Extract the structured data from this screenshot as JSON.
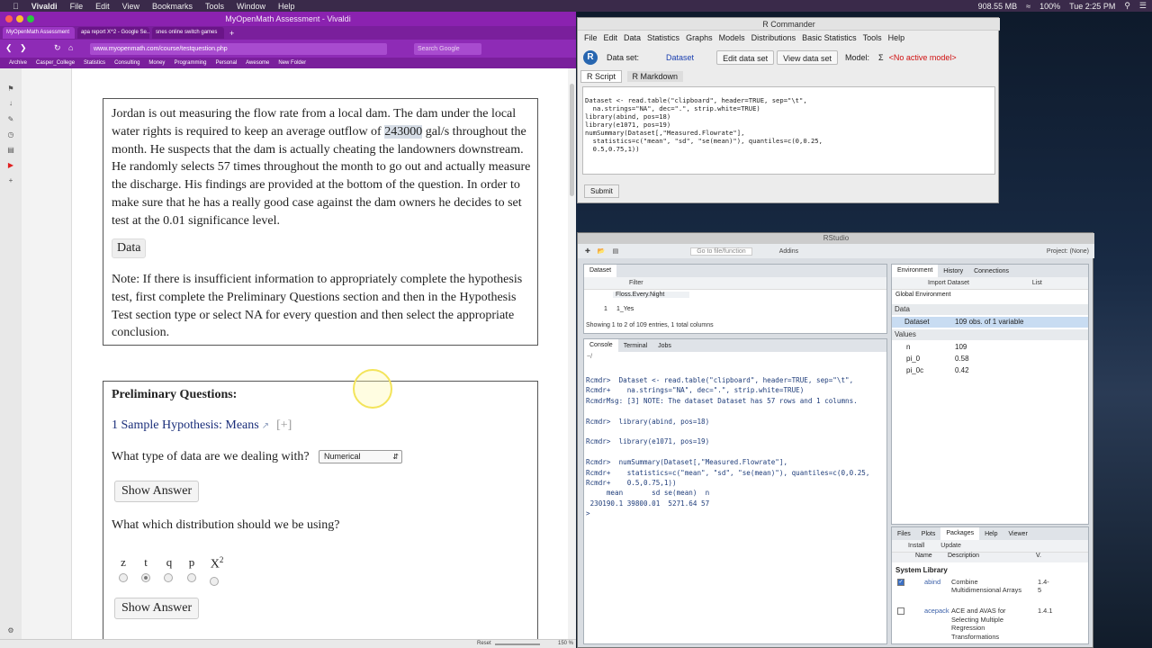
{
  "menubar": {
    "apple": "",
    "app": "Vivaldi",
    "items": [
      "File",
      "Edit",
      "View",
      "Bookmarks",
      "Tools",
      "Window",
      "Help"
    ],
    "memory": "908.55 MB",
    "battery": "100%",
    "clock": "Tue 2:25 PM"
  },
  "browser": {
    "title": "MyOpenMath Assessment - Vivaldi",
    "tabs": [
      "MyOpenMath Assessment",
      "apa report X^2 - Google Se...",
      "snes online switch games"
    ],
    "url": "www.myopenmath.com/course/testquestion.php",
    "search_placeholder": "Search Google",
    "bookmarks": [
      "Archive",
      "Casper_College",
      "Statistics",
      "Consulting",
      "Money",
      "Programming",
      "Personal",
      "Awesome",
      "New Folder"
    ],
    "status": {
      "reset": "Reset",
      "zoom": "150 %"
    }
  },
  "question": {
    "line1_pre": "Jordan is out measuring the flow rate from a local dam. The dam under the local water rights is required to keep an average outflow of ",
    "highlight": "243000",
    "line1_post": " gal/s throughout the month. He suspects that the dam is actually cheating the landowners downstream. He randomly selects 57 times throughout the month to go out and actually measure the discharge. His findings are provided at the bottom of the question. In order to make sure that he has a really good case against the dam owners he decides to set test at the 0.01 significance level.",
    "data_button": "Data",
    "note": "Note: If there is insufficient information to appropriately complete the hypothesis test, first complete the Preliminary Questions section and then in the Hypothesis Test section type or select NA for every question and then select the appropriate conclusion."
  },
  "prelim": {
    "heading": "Preliminary Questions:",
    "link": "1 Sample Hypothesis: Means",
    "plus": "[+]",
    "q1": "What type of data are we dealing with?",
    "q1_selected": "Numerical",
    "show_answer": "Show Answer",
    "q2": "What which distribution should we be using?",
    "dist_options": [
      "z",
      "t",
      "q",
      "p",
      "X"
    ],
    "dist_sup": "2",
    "selected_index": 1
  },
  "rcmdr": {
    "title": "R Commander",
    "menu": [
      "File",
      "Edit",
      "Data",
      "Statistics",
      "Graphs",
      "Models",
      "Distributions",
      "Basic Statistics",
      "Tools",
      "Help"
    ],
    "dataset_label": "Data set:",
    "dataset": "Dataset",
    "edit_btn": "Edit data set",
    "view_btn": "View data set",
    "model_label": "Model:",
    "model_sym": "Σ",
    "model_value": "<No active model>",
    "tabs": [
      "R Script",
      "R Markdown"
    ],
    "script": "Dataset <- read.table(\"clipboard\", header=TRUE, sep=\"\\t\",\n  na.strings=\"NA\", dec=\".\", strip.white=TRUE)\nlibrary(abind, pos=18)\nlibrary(e1071, pos=19)\nnumSummary(Dataset[,\"Measured.Flowrate\"],\n  statistics=c(\"mean\", \"sd\", \"se(mean)\"), quantiles=c(0,0.25,\n  0.5,0.75,1))",
    "submit": "Submit"
  },
  "rstudio": {
    "title": "RStudio",
    "toolbar": {
      "goto": "Go to file/function",
      "addins": "Addins",
      "project": "Project: (None)"
    },
    "viewer": {
      "tab": "Dataset",
      "filter": "Filter",
      "column": "Floss.Every.Night",
      "row_num": "1",
      "row_val": "1_Yes",
      "footer": "Showing 1 to 2 of 109 entries, 1 total columns"
    },
    "console": {
      "tabs": [
        "Console",
        "Terminal",
        "Jobs"
      ],
      "path": "~/",
      "text": "Rcmdr>  Dataset <- read.table(\"clipboard\", header=TRUE, sep=\"\\t\",\nRcmdr+    na.strings=\"NA\", dec=\".\", strip.white=TRUE)\nRcmdrMsg: [3] NOTE: The dataset Dataset has 57 rows and 1 columns.\n\nRcmdr>  library(abind, pos=18)\n\nRcmdr>  library(e1071, pos=19)\n\nRcmdr>  numSummary(Dataset[,\"Measured.Flowrate\"],\nRcmdr+    statistics=c(\"mean\", \"sd\", \"se(mean)\"), quantiles=c(0,0.25,\nRcmdr+    0.5,0.75,1))\n     mean       sd se(mean)  n\n 230190.1 39800.01  5271.64 57\n>"
    },
    "env": {
      "tabs": [
        "Environment",
        "History",
        "Connections"
      ],
      "import": "Import Dataset",
      "list": "List",
      "scope": "Global Environment",
      "data_hdr": "Data",
      "dataset_name": "Dataset",
      "dataset_desc": "109 obs. of 1 variable",
      "values_hdr": "Values",
      "values": [
        {
          "name": "n",
          "val": "109"
        },
        {
          "name": "pi_0",
          "val": "0.58"
        },
        {
          "name": "pi_0c",
          "val": "0.42"
        }
      ]
    },
    "packages": {
      "tabs": [
        "Files",
        "Plots",
        "Packages",
        "Help",
        "Viewer"
      ],
      "install": "Install",
      "update": "Update",
      "col_name": "Name",
      "col_desc": "Description",
      "col_ver": "V.",
      "library_hdr": "System Library",
      "rows": [
        {
          "name": "abind",
          "desc": "Combine Multidimensional Arrays",
          "ver": "1.4-5",
          "checked": true
        },
        {
          "name": "acepack",
          "desc": "ACE and AVAS for Selecting Multiple Regression Transformations",
          "ver": "1.4.1",
          "checked": false
        }
      ]
    }
  }
}
